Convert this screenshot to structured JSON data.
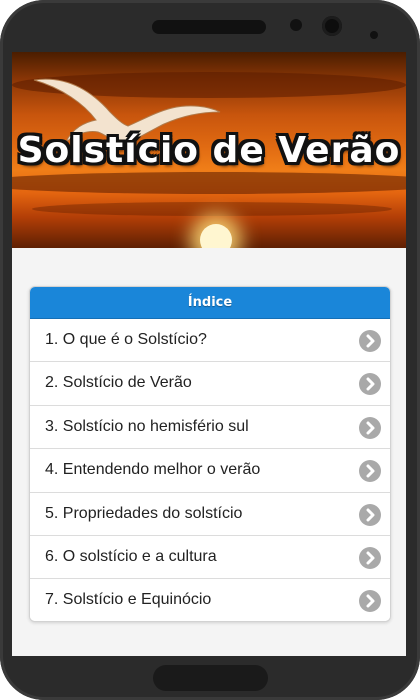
{
  "banner": {
    "title": "Solstício de Verão"
  },
  "index": {
    "header": "Índice",
    "items": [
      {
        "label": "1. O que é o Solstício?"
      },
      {
        "label": "2. Solstício de Verão"
      },
      {
        "label": "3. Solstício no hemisfério sul"
      },
      {
        "label": "4. Entendendo melhor o verão"
      },
      {
        "label": "5. Propriedades do solstício"
      },
      {
        "label": "6. O solstício e a cultura"
      },
      {
        "label": "7. Solstício e Equinócio"
      }
    ],
    "chevron_icon": "chevron-right-icon"
  },
  "colors": {
    "header_blue": "#1a86d9",
    "chevron_grey": "#a9a9a9",
    "sunset_orange": "#e06a12"
  }
}
